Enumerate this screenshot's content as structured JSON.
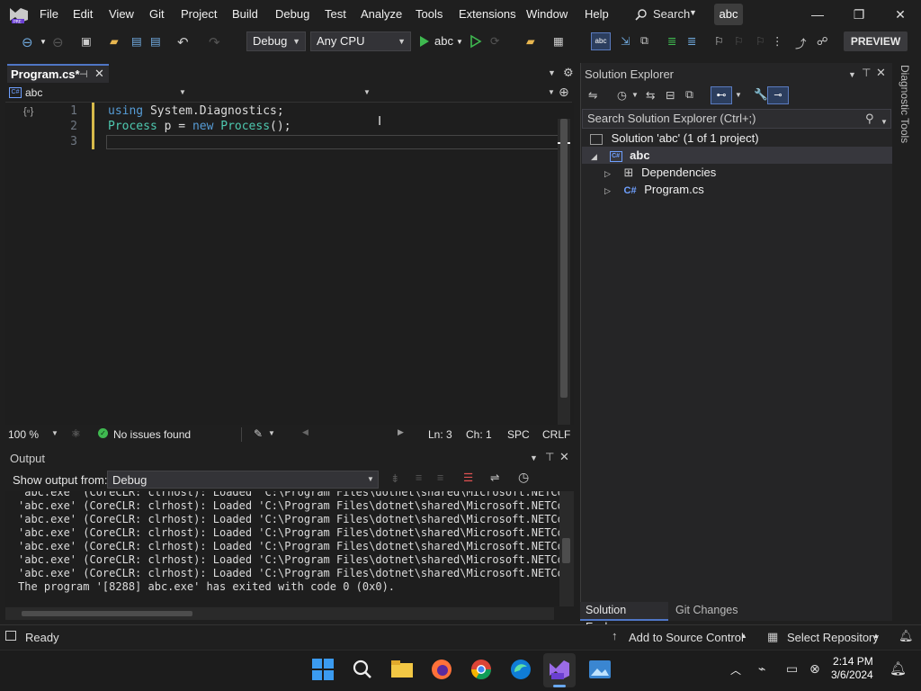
{
  "menu": {
    "items": [
      "File",
      "Edit",
      "View",
      "Git",
      "Project",
      "Build",
      "Debug",
      "Test",
      "Analyze",
      "Tools",
      "Extensions",
      "Window",
      "Help"
    ],
    "search_label": "Search",
    "solution_name": "abc"
  },
  "toolbar": {
    "configuration": "Debug",
    "platform": "Any CPU",
    "start_target": "abc",
    "preview_label": "PREVIEW"
  },
  "editor": {
    "tab_label": "Program.cs*",
    "project_dropdown": "abc",
    "lines": [
      {
        "number": "1",
        "tokens": [
          {
            "t": "using",
            "c": "kw"
          },
          {
            "t": " System.Diagnostics;",
            "c": "id"
          }
        ]
      },
      {
        "number": "2",
        "tokens": [
          {
            "t": "Process",
            "c": "ty"
          },
          {
            "t": " p = ",
            "c": "id"
          },
          {
            "t": "new",
            "c": "kw"
          },
          {
            "t": " ",
            "c": "id"
          },
          {
            "t": "Process",
            "c": "ty"
          },
          {
            "t": "();",
            "c": "id"
          }
        ]
      },
      {
        "number": "3",
        "tokens": []
      }
    ],
    "zoom": "100 %",
    "issues": "No issues found",
    "line_pos": "Ln: 3",
    "col_pos": "Ch: 1",
    "whitespace": "SPC",
    "line_ending": "CRLF"
  },
  "output": {
    "title": "Output",
    "show_from_label": "Show output from:",
    "source": "Debug",
    "lines": [
      "'abc.exe' (CoreCLR: clrhost): Loaded 'C:\\Program Files\\dotnet\\shared\\Microsoft.NETCore",
      "'abc.exe' (CoreCLR: clrhost): Loaded 'C:\\Program Files\\dotnet\\shared\\Microsoft.NETCore",
      "'abc.exe' (CoreCLR: clrhost): Loaded 'C:\\Program Files\\dotnet\\shared\\Microsoft.NETCore",
      "'abc.exe' (CoreCLR: clrhost): Loaded 'C:\\Program Files\\dotnet\\shared\\Microsoft.NETCore",
      "'abc.exe' (CoreCLR: clrhost): Loaded 'C:\\Program Files\\dotnet\\shared\\Microsoft.NETCore",
      "'abc.exe' (CoreCLR: clrhost): Loaded 'C:\\Program Files\\dotnet\\shared\\Microsoft.NETCore",
      "'abc.exe' (CoreCLR: clrhost): Loaded 'C:\\Program Files\\dotnet\\shared\\Microsoft.NETCore",
      "The program '[8288] abc.exe' has exited with code 0 (0x0)."
    ]
  },
  "solution_explorer": {
    "title": "Solution Explorer",
    "search_placeholder": "Search Solution Explorer (Ctrl+;)",
    "solution_label": "Solution 'abc' (1 of 1 project)",
    "project_label": "abc",
    "children": [
      "Dependencies",
      "Program.cs"
    ],
    "tabs": [
      "Solution Explorer",
      "Git Changes"
    ]
  },
  "diagnostic_tools_label": "Diagnostic Tools",
  "status": {
    "ready": "Ready",
    "source_control": "Add to Source Control",
    "repository": "Select Repository"
  },
  "clock": {
    "time": "2:14 PM",
    "date": "3/6/2024"
  },
  "colors": {
    "accent": "#4f76c5",
    "keyword": "#569cd6",
    "type": "#4ec9b0",
    "editor_bg": "#1e1e1e"
  }
}
